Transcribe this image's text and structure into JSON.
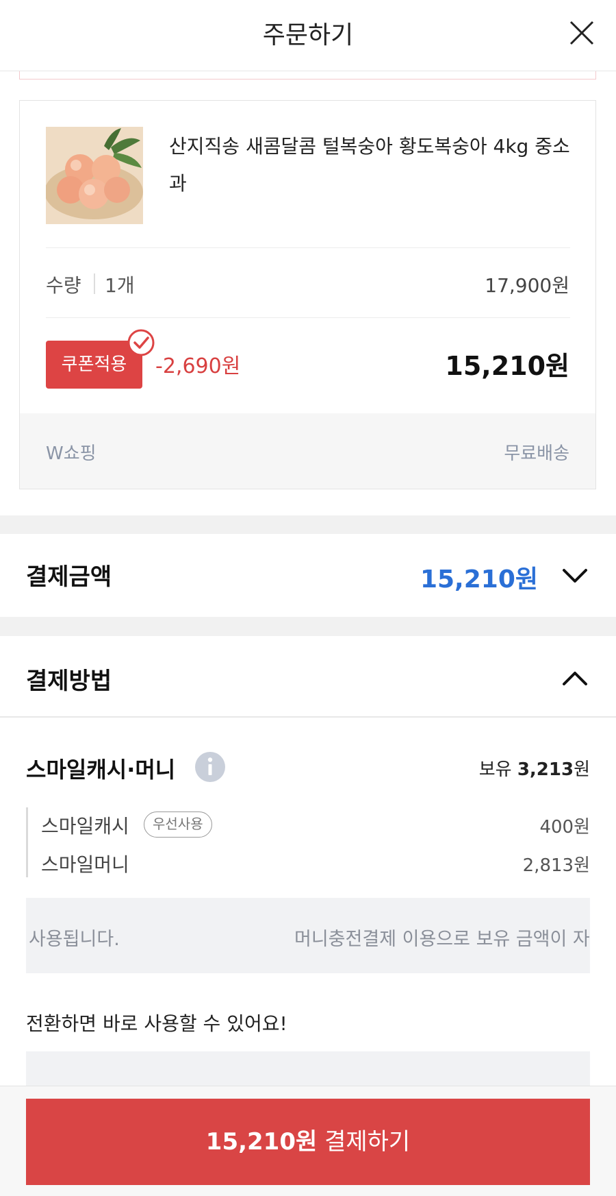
{
  "header": {
    "title": "주문하기",
    "close_icon": "close-icon"
  },
  "product": {
    "name": "산지직송 새콤달콤 털복숭아 황도복숭아 4kg 중소과",
    "thumb_icon": "peach-thumbnail",
    "quantity_label": "수량",
    "quantity_value": "1개",
    "line_price": "17,900원",
    "coupon_label": "쿠폰적용",
    "discount": "-2,690원",
    "final_price": "15,210원",
    "seller": "W쇼핑",
    "shipping": "무료배송"
  },
  "payment_total": {
    "label": "결제금액",
    "amount": "15,210원",
    "icon": "chevron-down-icon"
  },
  "payment_method": {
    "label": "결제방법",
    "icon": "chevron-up-icon"
  },
  "smile": {
    "title": "스마일캐시·머니",
    "hold_prefix": "보유",
    "hold_amount": "3,213",
    "hold_unit": "원",
    "cash_label": "스마일캐시",
    "priority_badge": "우선사용",
    "cash_value": "400원",
    "money_label": "스마일머니",
    "money_value": "2,813원",
    "notice_left": "사용됩니다.",
    "notice_right": "머니충전결제 이용으로 보유 금액이 자",
    "convert_text": "전환하면 바로 사용할 수 있어요!"
  },
  "pay_button": {
    "amount": "15,210원",
    "label": "결제하기"
  },
  "colors": {
    "accent_red": "#d94545",
    "price_blue": "#2a6fd6",
    "discount_red": "#d84040"
  }
}
